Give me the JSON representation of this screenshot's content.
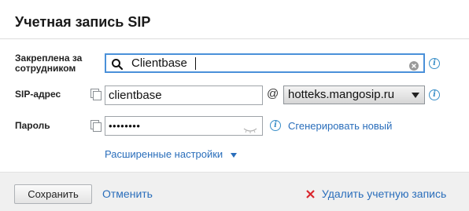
{
  "dialog": {
    "title": "Учетная запись SIP"
  },
  "fields": {
    "assigned_label": "Закреплена за сотрудником",
    "assigned_value": "Clientbase",
    "sip_label": "SIP-адрес",
    "sip_login": "clientbase",
    "at_sign": "@",
    "sip_domain": "hotteks.mangosip.ru",
    "password_label": "Пароль",
    "password_value": "••••••••",
    "generate_link": "Сгенерировать новый",
    "advanced_link": "Расширенные настройки"
  },
  "footer": {
    "save_label": "Сохранить",
    "cancel_label": "Отменить",
    "delete_label": "Удалить учетную запись"
  },
  "colors": {
    "link": "#2a6ebb",
    "focus_border": "#4a90d9",
    "delete_icon": "#d9272e"
  }
}
